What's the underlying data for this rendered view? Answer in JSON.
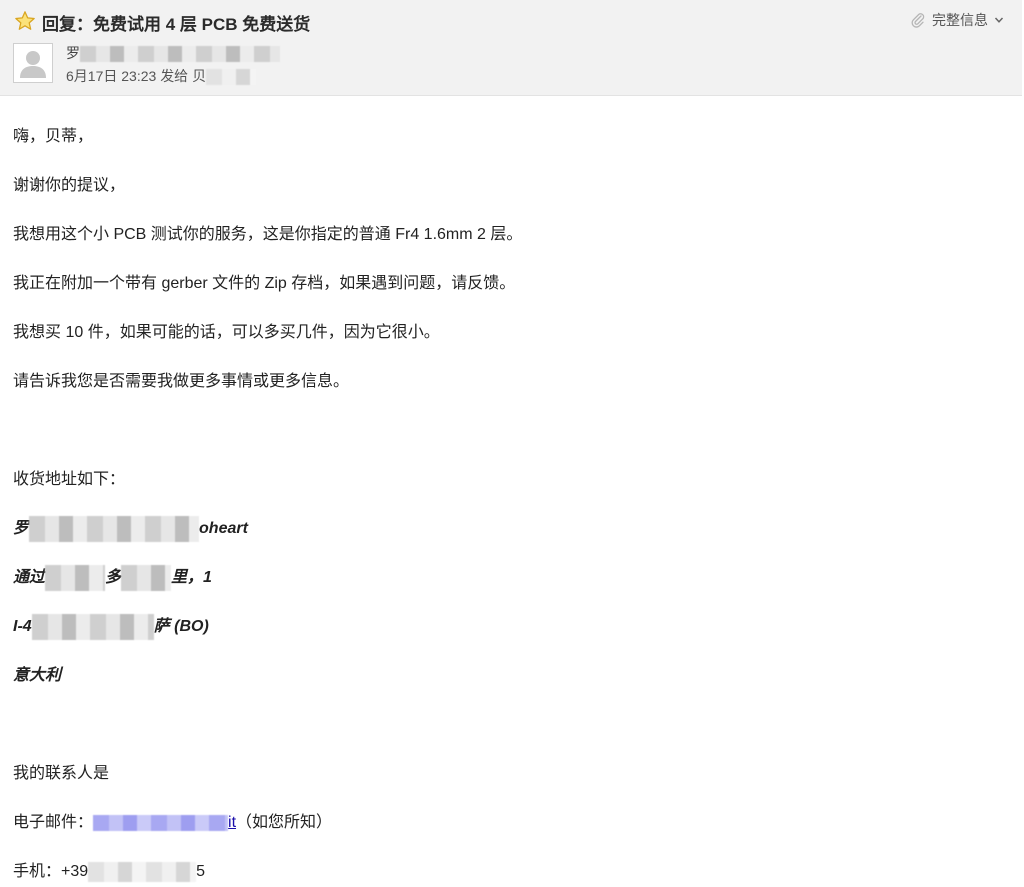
{
  "header": {
    "subject": "回复：免费试用 4 层 PCB 免费送货",
    "details_label": "完整信息",
    "sender_prefix": "罗",
    "date": "6月17日 23:23",
    "sent_to_label": "发给",
    "recipient_prefix": "贝"
  },
  "body": {
    "greeting": "嗨，贝蒂，",
    "thanks": "谢谢你的提议，",
    "p1": "我想用这个小 PCB 测试你的服务，这是你指定的普通 Fr4 1.6mm 2 层。",
    "p2": "我正在附加一个带有 gerber 文件的 Zip 存档，如果遇到问题，请反馈。",
    "p3": "我想买 10 件，如果可能的话，可以多买几件，因为它很小。",
    "p4": "请告诉我您是否需要我做更多事情或更多信息。",
    "address_heading": "收货地址如下：",
    "addr1_start": "罗",
    "addr1_end": "oheart",
    "addr2_start": "通过",
    "addr2_mid": "多",
    "addr2_end": "里，1",
    "addr3_start": "I-4",
    "addr3_end": "萨 (BO)",
    "addr4": "意大利",
    "contact_heading": "我的联系人是",
    "email_label": "电子邮件：",
    "email_tail": "it",
    "email_note": "（如您所知）",
    "phone_label": "手机：+39",
    "phone_tail": "5"
  },
  "colors": {
    "header_bg": "#f2f2f2",
    "star": "#f2c12e",
    "link": "#1a0dab"
  }
}
